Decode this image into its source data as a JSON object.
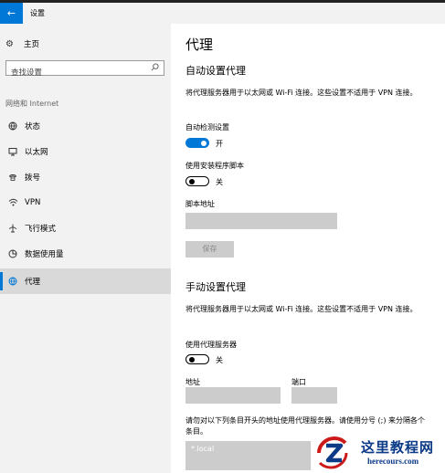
{
  "window": {
    "title": "设置",
    "back_glyph": "←"
  },
  "sidebar": {
    "home_label": "主页",
    "search_placeholder": "查找设置",
    "group_label": "网络和 Internet",
    "items": [
      {
        "label": "状态",
        "icon": "globe-icon"
      },
      {
        "label": "以太网",
        "icon": "monitor-icon"
      },
      {
        "label": "拨号",
        "icon": "phone-icon"
      },
      {
        "label": "VPN",
        "icon": "vpn-icon"
      },
      {
        "label": "飞行模式",
        "icon": "airplane-icon"
      },
      {
        "label": "数据使用量",
        "icon": "data-usage-icon"
      },
      {
        "label": "代理",
        "icon": "globe-icon",
        "active": true
      }
    ]
  },
  "main": {
    "page_title": "代理",
    "auto": {
      "title": "自动设置代理",
      "description": "将代理服务器用于以太网或 Wi-Fi 连接。这些设置不适用于 VPN 连接。",
      "detect_label": "自动检测设置",
      "detect_state": "开",
      "script_label": "使用安装程序脚本",
      "script_state": "关",
      "address_label": "脚本地址",
      "address_value": "",
      "save_label": "保存"
    },
    "manual": {
      "title": "手动设置代理",
      "description": "将代理服务器用于以太网或 Wi-Fi 连接。这些设置不适用于 VPN 连接。",
      "use_proxy_label": "使用代理服务器",
      "use_proxy_state": "关",
      "address_label": "地址",
      "port_label": "端口",
      "address_value": "",
      "port_value": "",
      "exceptions_description": "请勿对以下列条目开头的地址使用代理服务器。请使用分号 (;) 来分隔各个条目。",
      "exceptions_value": "*.local"
    }
  },
  "watermark": {
    "cn": "这里教程网",
    "en": "herecours.com"
  },
  "colors": {
    "accent": "#0078d7",
    "sidebar_bg": "#f2f2f2",
    "disabled": "#cccccc"
  }
}
